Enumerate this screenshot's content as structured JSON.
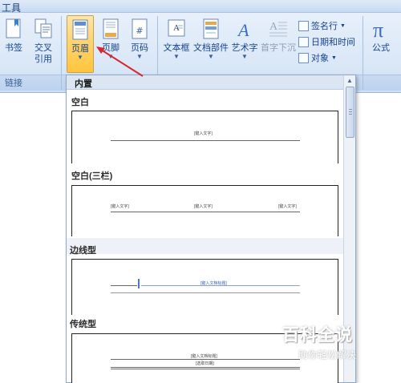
{
  "titlebar": {
    "title": "工具"
  },
  "ribbon": {
    "buttons": {
      "bookmark": "书签",
      "crossref_line1": "交叉",
      "crossref_line2": "引用",
      "header": "页眉",
      "footer": "页脚",
      "page_number": "页码",
      "textbox": "文本框",
      "quick_parts": "文档部件",
      "wordart": "艺术字",
      "dropcap": "首字下沉",
      "equation": "公式"
    },
    "small_buttons": {
      "signature_line": "签名行",
      "date_time": "日期和时间",
      "object": "对象"
    },
    "group_labels": {
      "links": "链接"
    }
  },
  "gallery": {
    "header": "内置",
    "sections": [
      {
        "label": "空白",
        "placeholders": [
          "[键入文字]"
        ]
      },
      {
        "label": "空白(三栏)",
        "placeholders": [
          "[键入文字]",
          "[键入文字]",
          "[键入文字]"
        ]
      },
      {
        "label": "边线型",
        "placeholders": [
          "[键入文档标题]"
        ]
      },
      {
        "label": "传统型",
        "placeholders": [
          "[键入文档标题]",
          "[选取日期]"
        ]
      }
    ]
  },
  "watermark": {
    "title": "百科全说",
    "subtitle": "助你轻松解决"
  },
  "colors": {
    "ribbon_bg": "#dbe8f7",
    "active_button": "#ffd26b",
    "annotation_arrow": "#d8262c",
    "ribbon_text": "#15428b"
  }
}
